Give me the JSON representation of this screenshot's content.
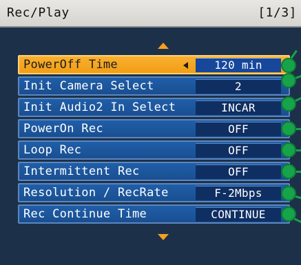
{
  "header": {
    "title": "Rec/Play",
    "page_indicator": "[1/3]"
  },
  "menu": {
    "items": [
      {
        "label": "PowerOff Time",
        "value": "120 min",
        "selected": true
      },
      {
        "label": "Init Camera Select",
        "value": "2",
        "selected": false
      },
      {
        "label": "Init Audio2 In Select",
        "value": "INCAR",
        "selected": false
      },
      {
        "label": "PowerOn Rec",
        "value": "OFF",
        "selected": false
      },
      {
        "label": "Loop Rec",
        "value": "OFF",
        "selected": false
      },
      {
        "label": "Intermittent Rec",
        "value": "OFF",
        "selected": false
      },
      {
        "label": "Resolution / RecRate",
        "value": "F-2Mbps",
        "selected": false
      },
      {
        "label": "Rec Continue Time",
        "value": "CONTINUE",
        "selected": false
      }
    ]
  },
  "colors": {
    "background": "#1c3149",
    "row": "#1f5ea8",
    "selected_row": "#f6a01e",
    "callout_dot": "#17a34a"
  },
  "icons": {
    "scroll_up": "triangle-up-icon",
    "scroll_down": "triangle-down-icon",
    "value_decrease": "triangle-left-icon",
    "callout": "green-dot-icon"
  }
}
